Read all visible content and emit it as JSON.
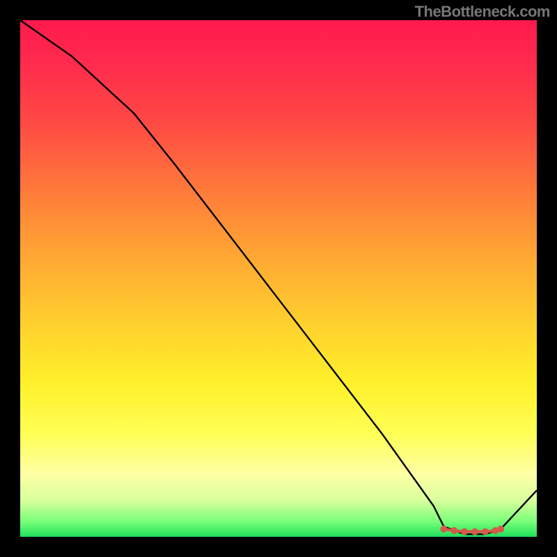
{
  "attribution": "TheBottleneck.com",
  "chart_data": {
    "type": "line",
    "title": "",
    "xlabel": "",
    "ylabel": "",
    "xlim": [
      0,
      100
    ],
    "ylim": [
      0,
      100
    ],
    "grid": false,
    "legend": false,
    "series": [
      {
        "name": "curve",
        "x": [
          0,
          10,
          22,
          30,
          40,
          50,
          60,
          70,
          80,
          82,
          86,
          90,
          93,
          100
        ],
        "y": [
          100,
          93,
          82,
          72,
          59,
          46,
          33,
          20,
          6,
          2,
          0.5,
          0.5,
          1.5,
          9
        ]
      }
    ],
    "markers": {
      "name": "optimum-band",
      "x": [
        82,
        84,
        86,
        88,
        90,
        92,
        93
      ],
      "y": [
        1.5,
        1.2,
        1.0,
        1.0,
        1.0,
        1.2,
        1.5
      ]
    },
    "colors": {
      "gradient_top": "#ff1a4d",
      "gradient_bottom": "#1fdf5a",
      "curve": "#000000",
      "marker": "#d45a4a",
      "frame": "#000000"
    }
  }
}
